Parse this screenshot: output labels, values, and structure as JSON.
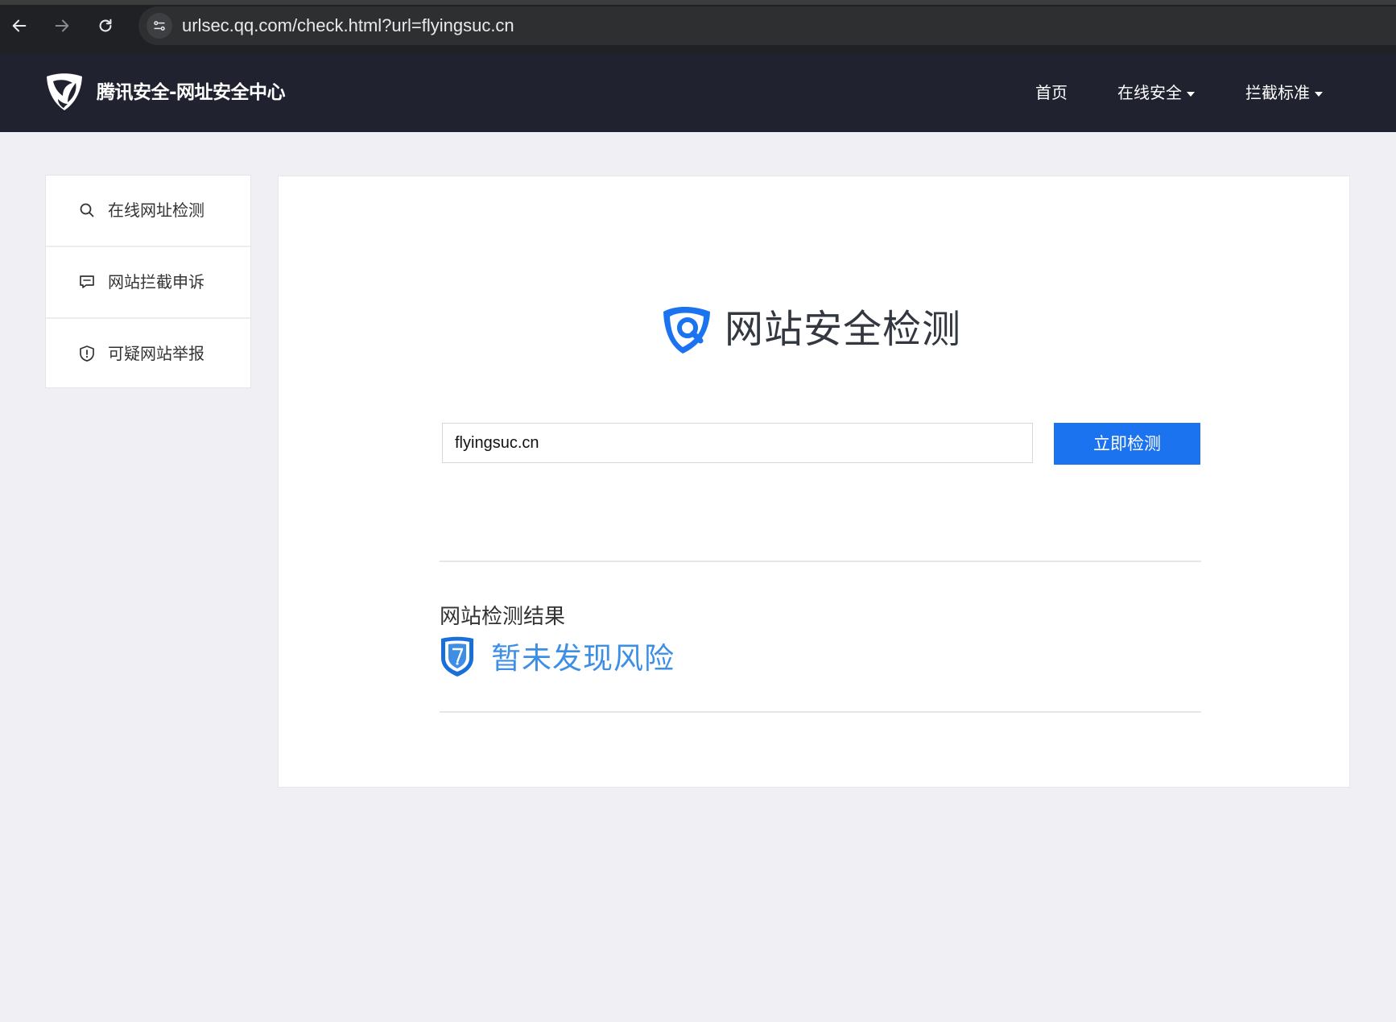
{
  "browser": {
    "url": "urlsec.qq.com/check.html?url=flyingsuc.cn"
  },
  "header": {
    "brand": "腾讯安全-网址安全中心",
    "nav": [
      {
        "label": "首页"
      },
      {
        "label": "在线安全"
      },
      {
        "label": "拦截标准"
      }
    ]
  },
  "sidebar": {
    "items": [
      {
        "label": "在线网址检测",
        "icon": "search-icon"
      },
      {
        "label": "网站拦截申诉",
        "icon": "chat-icon"
      },
      {
        "label": "可疑网站举报",
        "icon": "shield-alert-icon"
      }
    ]
  },
  "main": {
    "title": "网站安全检测",
    "search": {
      "value": "flyingsuc.cn"
    },
    "check_button": "立即检测",
    "result_heading": "网站检测结果",
    "result_text": "暂未发现风险"
  },
  "colors": {
    "header_bg": "#20222f",
    "accent": "#1b73f0",
    "result_blue": "#3d8fe6",
    "page_bg": "#efeff4"
  }
}
